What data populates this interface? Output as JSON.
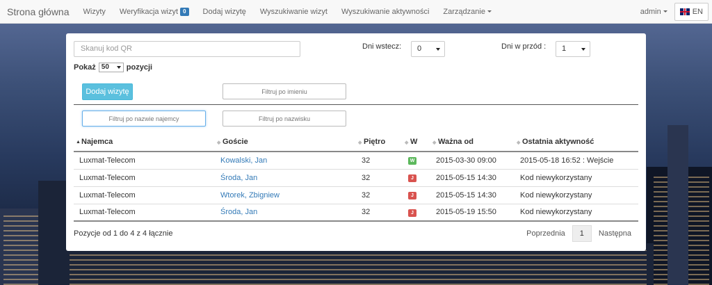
{
  "navbar": {
    "brand": "Strona główna",
    "items": [
      {
        "label": "Wizyty"
      },
      {
        "label": "Weryfikacja wizyt",
        "badge": "0"
      },
      {
        "label": "Dodaj wizytę"
      },
      {
        "label": "Wyszukiwanie wizyt"
      },
      {
        "label": "Wyszukiwanie aktywności"
      },
      {
        "label": "Zarządzanie"
      }
    ],
    "user": "admin",
    "language": "EN"
  },
  "filters": {
    "qr_placeholder": "Skanuj kod QR",
    "days_back_label": "Dni wstecz:",
    "days_back_value": "0",
    "days_forward_label": "Dni w przód :",
    "days_forward_value": "1",
    "show_label": "Pokaż",
    "show_value": "50",
    "show_suffix": "pozycji",
    "add_visit_button": "Dodaj wizytę",
    "filter_name": "Filtruj po imieniu",
    "filter_tenant": "Filtruj po nazwie najemcy",
    "filter_surname": "Filtruj po nazwisku"
  },
  "table": {
    "columns": [
      "Najemca",
      "Goście",
      "Piętro",
      "W",
      "Ważna od",
      "Ostatnia aktywność"
    ],
    "rows": [
      {
        "tenant": "Luxmat-Telecom",
        "guest": "Kowalski, Jan",
        "floor": "32",
        "w": "W",
        "valid_from": "2015-03-30 09:00",
        "last_activity": "2015-05-18 16:52 : Wejście"
      },
      {
        "tenant": "Luxmat-Telecom",
        "guest": "Środa, Jan",
        "floor": "32",
        "w": "J",
        "valid_from": "2015-05-15 14:30",
        "last_activity": "Kod niewykorzystany"
      },
      {
        "tenant": "Luxmat-Telecom",
        "guest": "Wtorek, Zbigniew",
        "floor": "32",
        "w": "J",
        "valid_from": "2015-05-15 14:30",
        "last_activity": "Kod niewykorzystany"
      },
      {
        "tenant": "Luxmat-Telecom",
        "guest": "Środa, Jan",
        "floor": "32",
        "w": "J",
        "valid_from": "2015-05-19 15:50",
        "last_activity": "Kod niewykorzystany"
      }
    ],
    "info": "Pozycje od 1 do 4 z 4 łącznie"
  },
  "pager": {
    "prev": "Poprzednia",
    "current": "1",
    "next": "Następna"
  },
  "colors": {
    "accent": "#5bc0de",
    "link": "#337ab7",
    "badge_green": "#5cb85c",
    "badge_red": "#d9534f"
  }
}
